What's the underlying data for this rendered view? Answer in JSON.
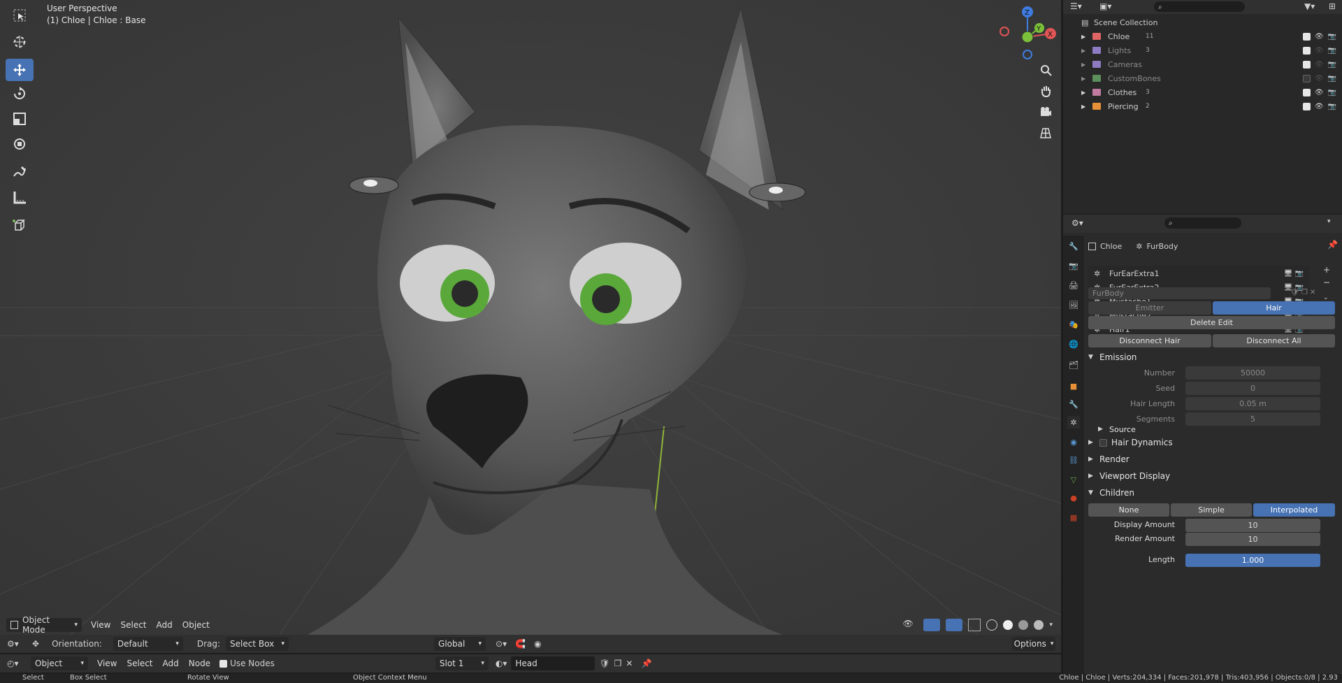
{
  "viewport": {
    "title": "User Perspective",
    "subtitle": "(1) Chloe | Chloe : Base",
    "header": {
      "mode": "Object Mode",
      "menus": [
        "View",
        "Select",
        "Add",
        "Object"
      ]
    },
    "gizmo_axes": [
      "Z",
      "Y",
      "X"
    ]
  },
  "tool_settings": {
    "orientation_label": "Orientation:",
    "orientation_value": "Default",
    "drag_label": "Drag:",
    "drag_value": "Select Box",
    "transform_orientation": "Global",
    "options_label": "Options"
  },
  "node_header": {
    "mode": "Object",
    "menus": [
      "View",
      "Select",
      "Add",
      "Node"
    ],
    "use_nodes_label": "Use Nodes",
    "slot": "Slot 1",
    "material": "Head"
  },
  "outliner": {
    "root": "Scene Collection",
    "items": [
      {
        "name": "Chloe",
        "count": "11",
        "color": "#e06666",
        "visible": true,
        "enabled": true
      },
      {
        "name": "Lights",
        "count": "3",
        "color": "#8e7cc3",
        "visible": false,
        "enabled": true
      },
      {
        "name": "Cameras",
        "count": "",
        "color": "#8e7cc3",
        "visible": false,
        "enabled": true
      },
      {
        "name": "CustomBones",
        "count": "",
        "color": "#5b8f5b",
        "visible": false,
        "enabled": false
      },
      {
        "name": "Clothes",
        "count": "3",
        "color": "#c27ba0",
        "visible": true,
        "enabled": true
      },
      {
        "name": "Piercing",
        "count": "2",
        "color": "#e69138",
        "visible": true,
        "enabled": true
      }
    ]
  },
  "properties": {
    "breadcrumb_object": "Chloe",
    "breadcrumb_system": "FurBody",
    "particle_systems": [
      "FurEarExtra1",
      "FurEarExtra2",
      "Mustache1",
      "Mustache2",
      "Hair1"
    ],
    "settings_name": "FurBody",
    "type_options": [
      "Emitter",
      "Hair"
    ],
    "type_selected": "Hair",
    "delete_edit": "Delete Edit",
    "disconnect_hair": "Disconnect Hair",
    "disconnect_all": "Disconnect All",
    "emission": {
      "title": "Emission",
      "fields": [
        {
          "label": "Number",
          "value": "50000"
        },
        {
          "label": "Seed",
          "value": "0"
        },
        {
          "label": "Hair Length",
          "value": "0.05 m"
        },
        {
          "label": "Segments",
          "value": "5"
        }
      ],
      "source": "Source"
    },
    "panels": [
      "Hair Dynamics",
      "Render",
      "Viewport Display"
    ],
    "children": {
      "title": "Children",
      "options": [
        "None",
        "Simple",
        "Interpolated"
      ],
      "selected": "Interpolated",
      "display_amount_label": "Display Amount",
      "display_amount": "10",
      "render_amount_label": "Render Amount",
      "render_amount": "10",
      "length_label": "Length",
      "length": "1.000"
    }
  },
  "status_bar": {
    "select": "Select",
    "box_select": "Box Select",
    "rotate_view": "Rotate View",
    "context_menu": "Object Context Menu",
    "stats": "Chloe | Chloe | Verts:204,334 | Faces:201,978 | Tris:403,956 | Objects:0/8 | 2.93"
  }
}
